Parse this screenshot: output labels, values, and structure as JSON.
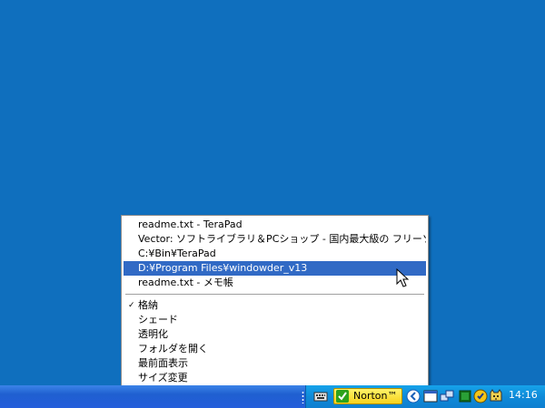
{
  "context_menu": {
    "recent_items": [
      {
        "label": "readme.txt - TeraPad"
      },
      {
        "label": "Vector: ソフトライブラリ＆PCショップ - 国内最大級の フリーソフ"
      },
      {
        "label": "C:¥Bin¥TeraPad"
      },
      {
        "label": "D:¥Program Files¥windowder_v13"
      },
      {
        "label": "readme.txt - メモ帳"
      }
    ],
    "highlighted_index": 3,
    "actions": [
      {
        "label": "格納",
        "checked": true
      },
      {
        "label": "シェード",
        "checked": false
      },
      {
        "label": "透明化",
        "checked": false
      },
      {
        "label": "フォルダを開く",
        "checked": false
      },
      {
        "label": "最前面表示",
        "checked": false
      },
      {
        "label": "サイズ変更",
        "checked": false
      }
    ],
    "check_mark": "✓"
  },
  "taskbar": {
    "tray": {
      "norton_label": "Norton™",
      "clock": "14:16"
    },
    "icons": [
      "keyboard-icon",
      "norton-check-icon",
      "chevron-left-icon",
      "window-icon",
      "network-icon",
      "green-square-icon",
      "shield-icon",
      "cat-icon"
    ]
  },
  "colors": {
    "desktop": "#0f6fbe",
    "menu_highlight": "#316ac5",
    "taskbar": "#245edb",
    "tray": "#0f8ad8",
    "norton": "#f7d21c"
  }
}
